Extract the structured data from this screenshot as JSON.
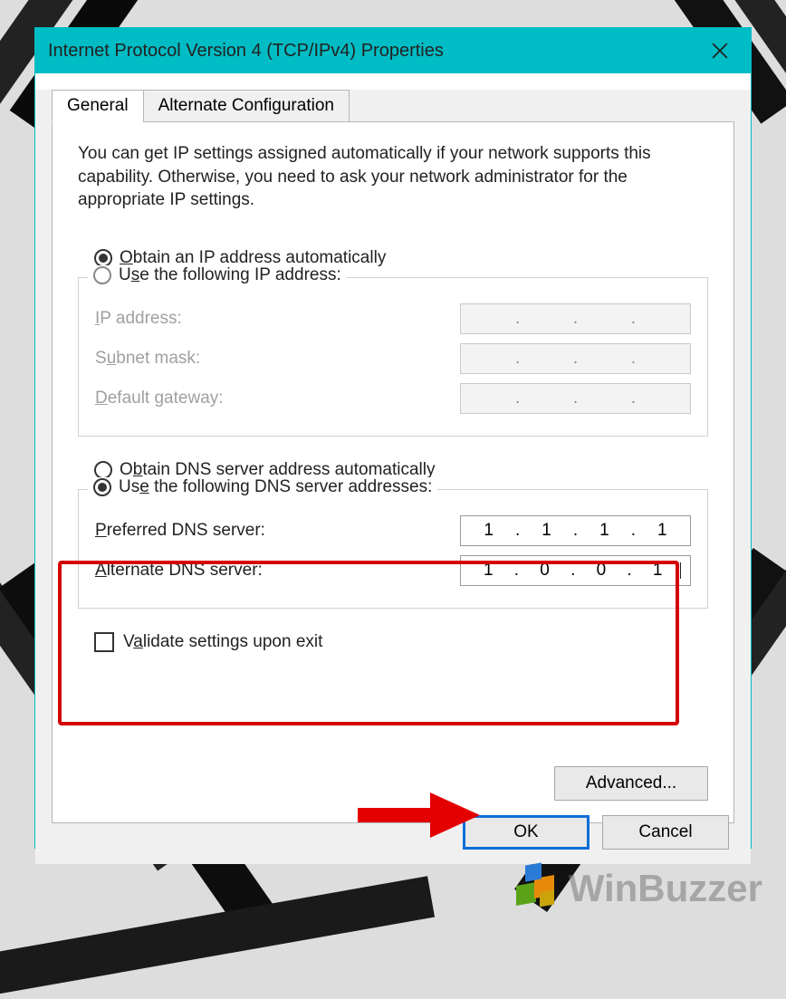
{
  "window": {
    "title": "Internet Protocol Version 4 (TCP/IPv4) Properties"
  },
  "tabs": {
    "general": "General",
    "alternate": "Alternate Configuration"
  },
  "intro": "You can get IP settings assigned automatically if your network supports this capability. Otherwise, you need to ask your network administrator for the appropriate IP settings.",
  "ip": {
    "auto_label_pre": "O",
    "auto_label_rest": "btain an IP address automatically",
    "manual_label_pre": "U",
    "manual_label_mid": "s",
    "manual_label_rest": "e the following IP address:",
    "ip_label_pre": "I",
    "ip_label_rest": "P address:",
    "subnet_label_pre": "S",
    "subnet_label_mid": "u",
    "subnet_label_rest": "bnet mask:",
    "gateway_label_pre": "D",
    "gateway_label_rest": "efault gateway:",
    "ip_value": [
      "",
      "",
      "",
      ""
    ],
    "subnet_value": [
      "",
      "",
      "",
      ""
    ],
    "gateway_value": [
      "",
      "",
      "",
      ""
    ]
  },
  "dns": {
    "auto_label_pre": "O",
    "auto_label_mid": "b",
    "auto_label_rest": "tain DNS server address automatically",
    "manual_label_pre": "Us",
    "manual_label_mid": "e",
    "manual_label_rest": " the following DNS server addresses:",
    "preferred_label_pre": "P",
    "preferred_label_rest": "referred DNS server:",
    "alternate_label_pre": "A",
    "alternate_label_rest": "lternate DNS server:",
    "preferred_value": [
      "1",
      "1",
      "1",
      "1"
    ],
    "alternate_value": [
      "1",
      "0",
      "0",
      "1"
    ]
  },
  "validate": {
    "label_pre": "V",
    "label_mid": "a",
    "label_rest": "lidate settings upon exit",
    "checked": false
  },
  "buttons": {
    "advanced": "Advanced...",
    "ok": "OK",
    "cancel": "Cancel"
  },
  "watermark": "WinBuzzer",
  "colors": {
    "titlebar": "#00bcc4",
    "highlight": "#d40000",
    "primary_border": "#0a6fd6"
  }
}
